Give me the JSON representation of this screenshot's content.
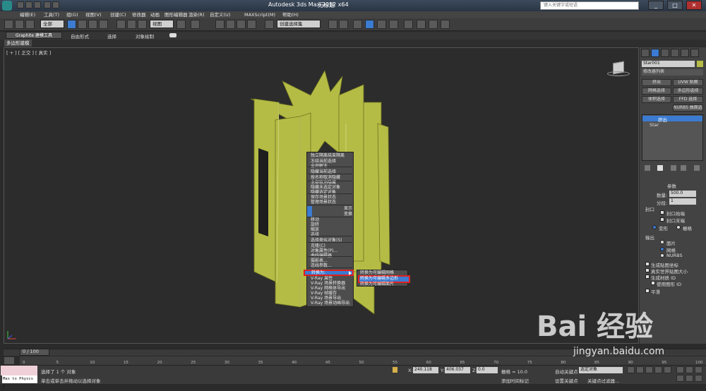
{
  "window": {
    "title": "Autodesk 3ds Max  2012 x64",
    "document": "无标题",
    "search_placeholder": "键入关键字或短语",
    "min": "_",
    "max": "□",
    "close": "✕"
  },
  "menu": [
    "编辑(E)",
    "工具(T)",
    "组(G)",
    "视图(V)",
    "创建(C)",
    "修改器",
    "动画",
    "图形编辑器",
    "渲染(R)",
    "自定义(U)",
    "MAXScript(M)",
    "帮助(H)"
  ],
  "toolbar": {
    "filter_value": "全部",
    "refcoord_value": "视图",
    "selection_set_placeholder": "创建选择集"
  },
  "ribbon": {
    "tabs": [
      "Graphite 建模工具",
      "自由形式",
      "选择",
      "对象绘制"
    ],
    "sub_tab": "多边形建模"
  },
  "viewport": {
    "label": "[ + ] [ 正交 ] [ 真实 ]"
  },
  "context_menu": {
    "items": [
      "独立隔离结束隔离",
      "冻结当前选择",
      "全部解冻",
      "隐藏当前选择",
      "按名称取消隐藏",
      "全部取消隐藏",
      "隐藏未选定对象",
      "隐藏选定对象",
      "保存场景状态",
      "管理场景状态",
      "显示",
      "变换",
      "移动",
      "旋转",
      "缩放",
      "选择",
      "选择类似对象(S)",
      "克隆(C)",
      "对象属性(P)...",
      "曲线编辑器...",
      "摄影表...",
      "连线参数...",
      "转换为:",
      "V-Ray 属性",
      "V-Ray 场景转换器",
      "V-Ray 网格体导出",
      "V-Ray 帧缓存",
      "V-Ray 场景导出",
      "V-Ray 场景动画导出"
    ],
    "section_display": "显示",
    "section_transform": "变换",
    "convert_label": "转换为:",
    "submenu": [
      "转换为可编辑网格",
      "转换为可编辑多边形",
      "转换为可编辑面片"
    ]
  },
  "command_panel": {
    "object_name": "Star001",
    "modifier_list": "修改器列表",
    "buttons": [
      "挤出",
      "UVW 贴图",
      "网格选择",
      "多边形选择",
      "体积选择",
      "FFD 选择",
      "NURBS 曲面选择"
    ],
    "stack": [
      "挤出",
      "Star"
    ],
    "params_title": "参数",
    "amount_label": "数量:",
    "amount_value": "500.0",
    "segments_label": "分段:",
    "segments_value": "1",
    "capping_title": "封口",
    "cap_start": "封口始端",
    "cap_end": "封口末端",
    "morph": "变形",
    "grid": "栅格",
    "output_title": "输出",
    "output_patch": "面片",
    "output_mesh": "网格",
    "output_nurbs": "NURBS",
    "gen_map": "生成贴图坐标",
    "real_world": "真实世界贴图大小",
    "gen_mat_ids": "生成材质 ID",
    "use_shape_ids": "使用图形 ID",
    "smooth": "平滑"
  },
  "timeline": {
    "frame": "0 / 100",
    "ticks": [
      "0",
      "5",
      "10",
      "15",
      "20",
      "25",
      "30",
      "35",
      "40",
      "45",
      "50",
      "55",
      "60",
      "65",
      "70",
      "75",
      "80",
      "85",
      "90",
      "95",
      "100"
    ]
  },
  "status": {
    "script_label": "Max to Physcs C",
    "selected": "选择了 1 个 对象",
    "hint": "单击或单击并拖动以选择对象",
    "x_label": "X:",
    "x_value": "240.118",
    "y_label": "Y:",
    "y_value": "406.037",
    "z_label": "Z:",
    "z_value": "0.0",
    "grid": "栅格 = 10.0",
    "add_time_tag": "添加时间标记",
    "auto_key": "自动关键点",
    "selected_obj": "选定对象",
    "set_key": "设置关键点",
    "key_filters": "关键点过滤器..."
  },
  "watermark": {
    "logo": "Bai 经验",
    "url": "jingyan.baidu.com"
  },
  "colors": {
    "object": "#b5bc45",
    "highlight": "#3b7bd1",
    "callout": "#e02020"
  }
}
